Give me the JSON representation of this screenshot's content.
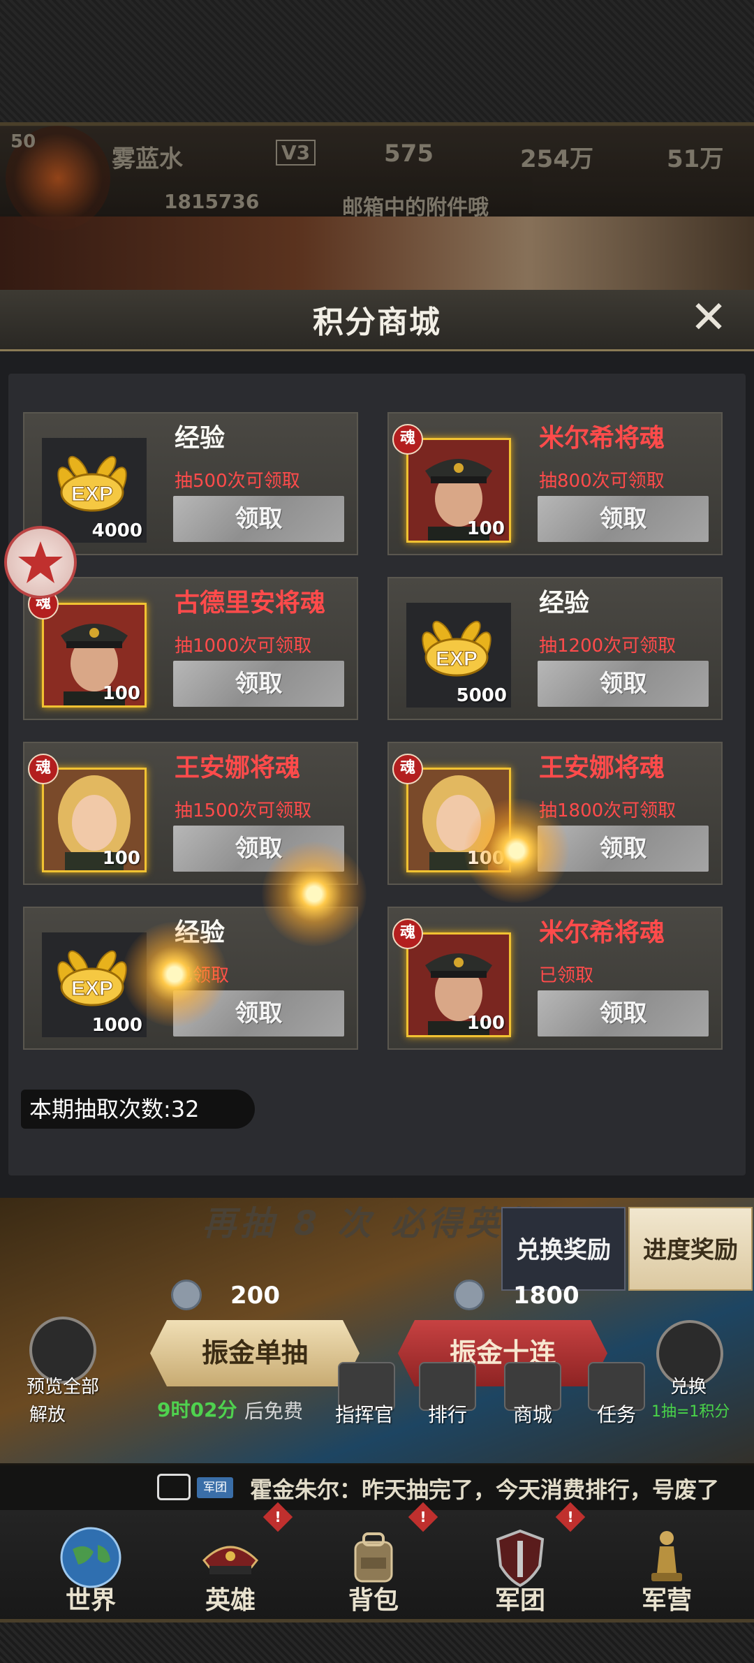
{
  "hud": {
    "level": "50",
    "player_name": "雾蓝水",
    "vip": "V3",
    "stat1": "575",
    "stat2": "254万",
    "stat3": "51万",
    "power": "1815736",
    "notice": "邮箱中的附件哦"
  },
  "modal": {
    "title": "积分商城",
    "close_icon": "close-icon"
  },
  "rewards": [
    {
      "title": "经验",
      "title_color": "white",
      "type": "exp",
      "quantity": "4000",
      "condition": "抽500次可领取",
      "button": "领取",
      "soul_badge": ""
    },
    {
      "title": "米尔希将魂",
      "title_color": "red",
      "type": "hero-officer",
      "quantity": "100",
      "condition": "抽800次可领取",
      "button": "领取",
      "soul_badge": "魂"
    },
    {
      "title": "古德里安将魂",
      "title_color": "red",
      "type": "hero-general",
      "quantity": "100",
      "condition": "抽1000次可领取",
      "button": "领取",
      "soul_badge": "魂"
    },
    {
      "title": "经验",
      "title_color": "white",
      "type": "exp",
      "quantity": "5000",
      "condition": "抽1200次可领取",
      "button": "领取",
      "soul_badge": ""
    },
    {
      "title": "王安娜将魂",
      "title_color": "red",
      "type": "hero-woman",
      "quantity": "100",
      "condition": "抽1500次可领取",
      "button": "领取",
      "soul_badge": "魂"
    },
    {
      "title": "王安娜将魂",
      "title_color": "red",
      "type": "hero-woman",
      "quantity": "100",
      "condition": "抽1800次可领取",
      "button": "领取",
      "soul_badge": "魂"
    },
    {
      "title": "经验",
      "title_color": "white",
      "type": "exp",
      "quantity": "1000",
      "condition": "已领取",
      "button": "领取",
      "soul_badge": ""
    },
    {
      "title": "米尔希将魂",
      "title_color": "red",
      "type": "hero-officer",
      "quantity": "100",
      "condition": "已领取",
      "button": "领取",
      "soul_badge": "魂"
    }
  ],
  "draw_count": "本期抽取次数:32",
  "summon": {
    "banner": "再抽 8 次 必得英雄",
    "tab_exchange": "兑换奖励",
    "tab_progress": "进度奖励",
    "single_cost": "200",
    "ten_cost": "1800",
    "single_label": "振金单抽",
    "ten_label": "振金十连",
    "preview_label": "预览全部",
    "unlock_label": "解放",
    "free_time": "9时02分",
    "free_suffix": "后免费",
    "exchange_label": "兑换",
    "exchange_rate": "1抽=1积分",
    "menu": [
      "指挥官",
      "排行",
      "商城",
      "任务"
    ]
  },
  "chat": {
    "tag": "军团",
    "message": "霍金朱尔：昨天抽完了，今天消费排行，号废了"
  },
  "nav": [
    {
      "label": "世界",
      "icon": "globe-icon"
    },
    {
      "label": "英雄",
      "icon": "officer-cap-icon"
    },
    {
      "label": "背包",
      "icon": "backpack-icon"
    },
    {
      "label": "军团",
      "icon": "shield-icon"
    },
    {
      "label": "军营",
      "icon": "chess-piece-icon"
    }
  ],
  "alert_mark": "!",
  "colors": {
    "accent_gold": "#f1c232",
    "title_red": "#ff4b4b",
    "free_green": "#4fd24f"
  }
}
